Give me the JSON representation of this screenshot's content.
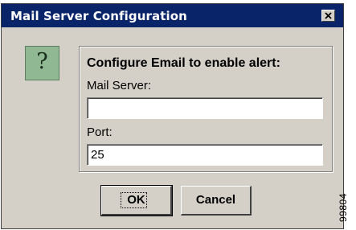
{
  "window": {
    "title": "Mail Server Configuration",
    "close_icon": "close-icon"
  },
  "icon": {
    "name": "help-question-icon",
    "glyph": "?"
  },
  "panel": {
    "heading": "Configure Email to enable alert:",
    "mail_server_label": "Mail Server:",
    "mail_server_value": "",
    "port_label": "Port:",
    "port_value": "25"
  },
  "buttons": {
    "ok_label": "OK",
    "cancel_label": "Cancel"
  },
  "figure_id": "99804",
  "colors": {
    "titlebar": "#0a246a",
    "dialog_background": "#d4d0c8",
    "icon_background": "#8fb893"
  }
}
